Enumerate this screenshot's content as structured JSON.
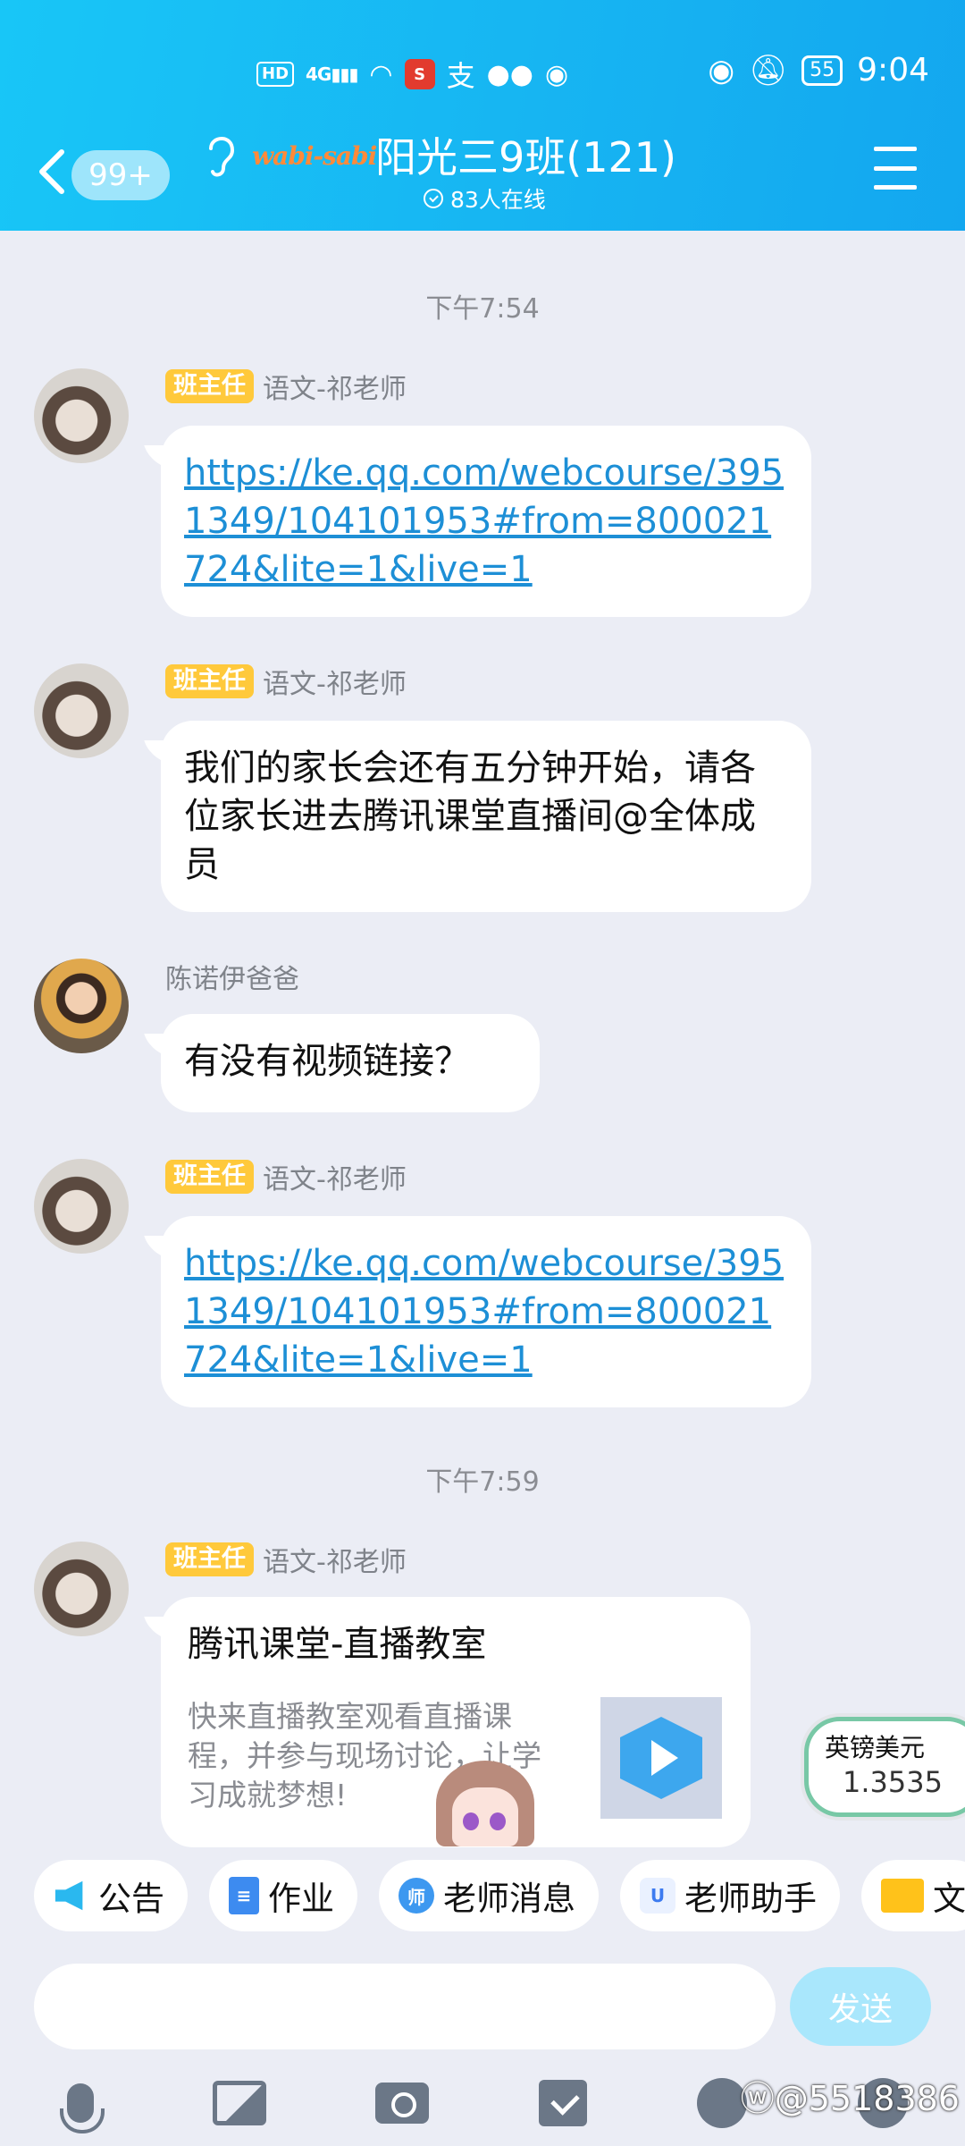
{
  "status_bar": {
    "hd": "HD",
    "signal": "4G",
    "app_icon": "S",
    "alipay_glyph": "支",
    "battery": "55",
    "time": "9:04"
  },
  "header": {
    "back_badge": "99+",
    "logo_text": "wabi-sabi",
    "title": "阳光三9班(121)",
    "online": "83人在线"
  },
  "timestamps": [
    "下午7:54",
    "下午7:59"
  ],
  "messages": [
    {
      "role": "班主任",
      "sender": "语文-祁老师",
      "text": "https://ke.qq.com/webcourse/3951349/104101953#from=800021724&lite=1&live=1"
    },
    {
      "role": "班主任",
      "sender": "语文-祁老师",
      "text": "我们的家长会还有五分钟开始，请各位家长进去腾讯课堂直播间@全体成员"
    },
    {
      "sender": "陈诺伊爸爸",
      "text": "有没有视频链接？"
    },
    {
      "role": "班主任",
      "sender": "语文-祁老师",
      "text": "https://ke.qq.com/webcourse/3951349/104101953#from=800021724&lite=1&live=1"
    },
    {
      "role": "班主任",
      "sender": "语文-祁老师",
      "card_title": "腾讯课堂-直播教室",
      "card_desc": "快来直播教室观看直播课程，并参与现场讨论，让学习成就梦想!"
    }
  ],
  "rate_widget": {
    "label": "英镑美元",
    "value": "1.3535"
  },
  "quickbar": [
    {
      "label": "公告",
      "icon": "megaphone-icon",
      "glyph": ""
    },
    {
      "label": "作业",
      "icon": "document-icon",
      "glyph": ""
    },
    {
      "label": "老师消息",
      "icon": "teacher-message-icon",
      "glyph": "师"
    },
    {
      "label": "老师助手",
      "icon": "assistant-icon",
      "glyph": "U"
    },
    {
      "label": "文",
      "icon": "folder-icon",
      "glyph": ""
    }
  ],
  "input": {
    "placeholder": "",
    "send_label": "发送"
  },
  "watermark": "@5518386",
  "colors": {
    "header": "#17b5f2",
    "link": "#1d8fd6",
    "role_badge": "#ffc93b",
    "background": "#ebedf5"
  }
}
